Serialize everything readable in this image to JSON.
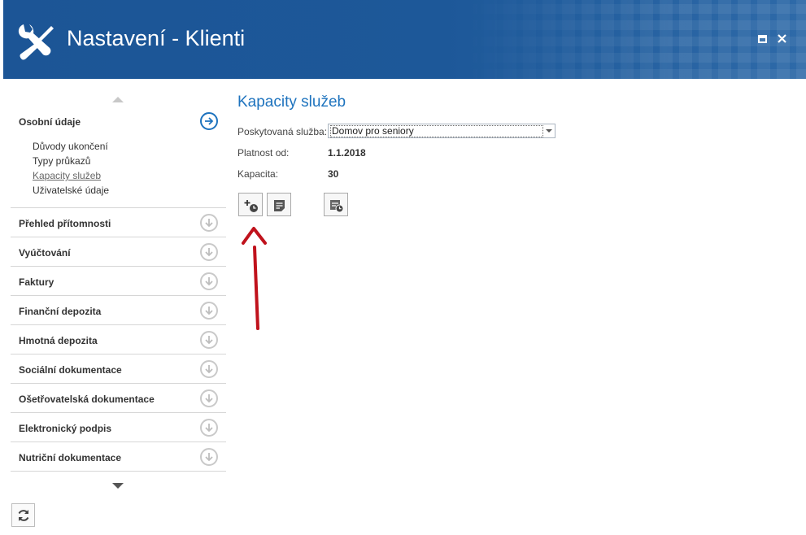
{
  "window": {
    "title": "Nastavení - Klienti"
  },
  "sidebar": {
    "active_section": {
      "label": "Osobní údaje",
      "items": [
        {
          "label": "Důvody ukončení"
        },
        {
          "label": "Typy průkazů"
        },
        {
          "label": "Kapacity služeb"
        },
        {
          "label": "Uživatelské údaje"
        }
      ]
    },
    "sections": [
      {
        "label": "Přehled přítomnosti"
      },
      {
        "label": "Vyúčtování"
      },
      {
        "label": "Faktury"
      },
      {
        "label": "Finanční depozita"
      },
      {
        "label": "Hmotná depozita"
      },
      {
        "label": "Sociální dokumentace"
      },
      {
        "label": "Ošetřovatelská dokumentace"
      },
      {
        "label": "Elektronický podpis"
      },
      {
        "label": "Nutriční dokumentace"
      }
    ]
  },
  "content": {
    "title": "Kapacity služeb",
    "service_label": "Poskytovaná služba:",
    "service_value": "Domov pro seniory",
    "valid_from_label": "Platnost od:",
    "valid_from_value": "1.1.2018",
    "capacity_label": "Kapacita:",
    "capacity_value": "30"
  },
  "colors": {
    "header_bg": "#1f5a9a",
    "accent": "#1e73be",
    "annotation_arrow": "#c0121c"
  }
}
